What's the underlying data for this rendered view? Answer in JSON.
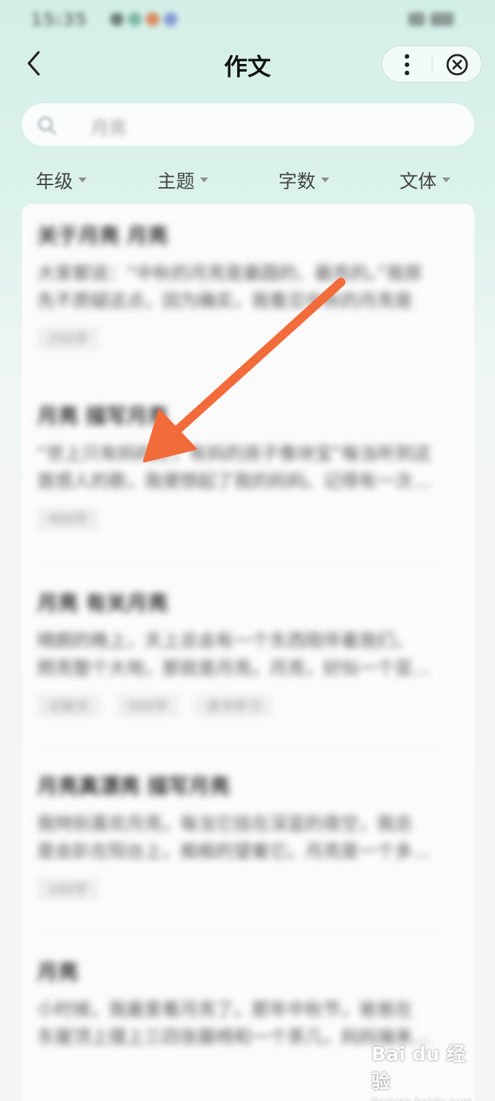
{
  "status_bar": {
    "time": "15:35"
  },
  "nav": {
    "title": "作文",
    "back_icon": "chevron-left-icon",
    "more_icon": "more-vertical-icon",
    "close_icon": "close-circle-icon"
  },
  "search": {
    "value": "月亮",
    "icon": "search-icon"
  },
  "filters": [
    {
      "label": "年级"
    },
    {
      "label": "主题"
    },
    {
      "label": "字数"
    },
    {
      "label": "文体"
    }
  ],
  "results": [
    {
      "title": "关于月亮 月亮",
      "excerpt_1": "大家都说：“中秋的月亮是最圆的、最亮的。”我原",
      "excerpt_2": "先不质疑这点，因为确实，我看见中秋的月亮是",
      "tags": [
        "250字"
      ]
    },
    {
      "title": "月亮 描写月亮",
      "excerpt_1": "“世上只有妈妈好，有妈的孩子像块宝”每当听到这",
      "excerpt_2": "首感人的歌，我便想起了我的妈妈。记得有一次…",
      "tags": [
        "400字"
      ]
    },
    {
      "title": "月亮 有关月亮",
      "excerpt_1": "晴朗的晚上，天上总会有一个东西陪伴着我们，",
      "excerpt_2": "照亮整个大地，那就是月亮。月亮，好似一个亚…",
      "tags": [
        "记叙文",
        "500字",
        "读书学习"
      ]
    },
    {
      "title": "月亮真漂亮 描写月亮",
      "excerpt_1": "我特别喜欢月亮，每当它挂在深蓝的夜空，我总",
      "excerpt_2": "是会趴在阳台上，痴痴的望着它。月亮是一个多…",
      "tags": [
        "100字"
      ]
    },
    {
      "title": "月亮",
      "excerpt_1": "小时候，我最爱看月亮了。那年中秋节，爸爸在",
      "excerpt_2": "东屋顶上摆上三四张藤椅和一个茶几，妈妈端来…",
      "tags": []
    }
  ],
  "watermark": {
    "logo": "Bai du 经验",
    "sub": "jingyan.baidu.com"
  },
  "colors": {
    "annotation_arrow": "#f26b3a",
    "header_bg": "#d4efe8"
  }
}
